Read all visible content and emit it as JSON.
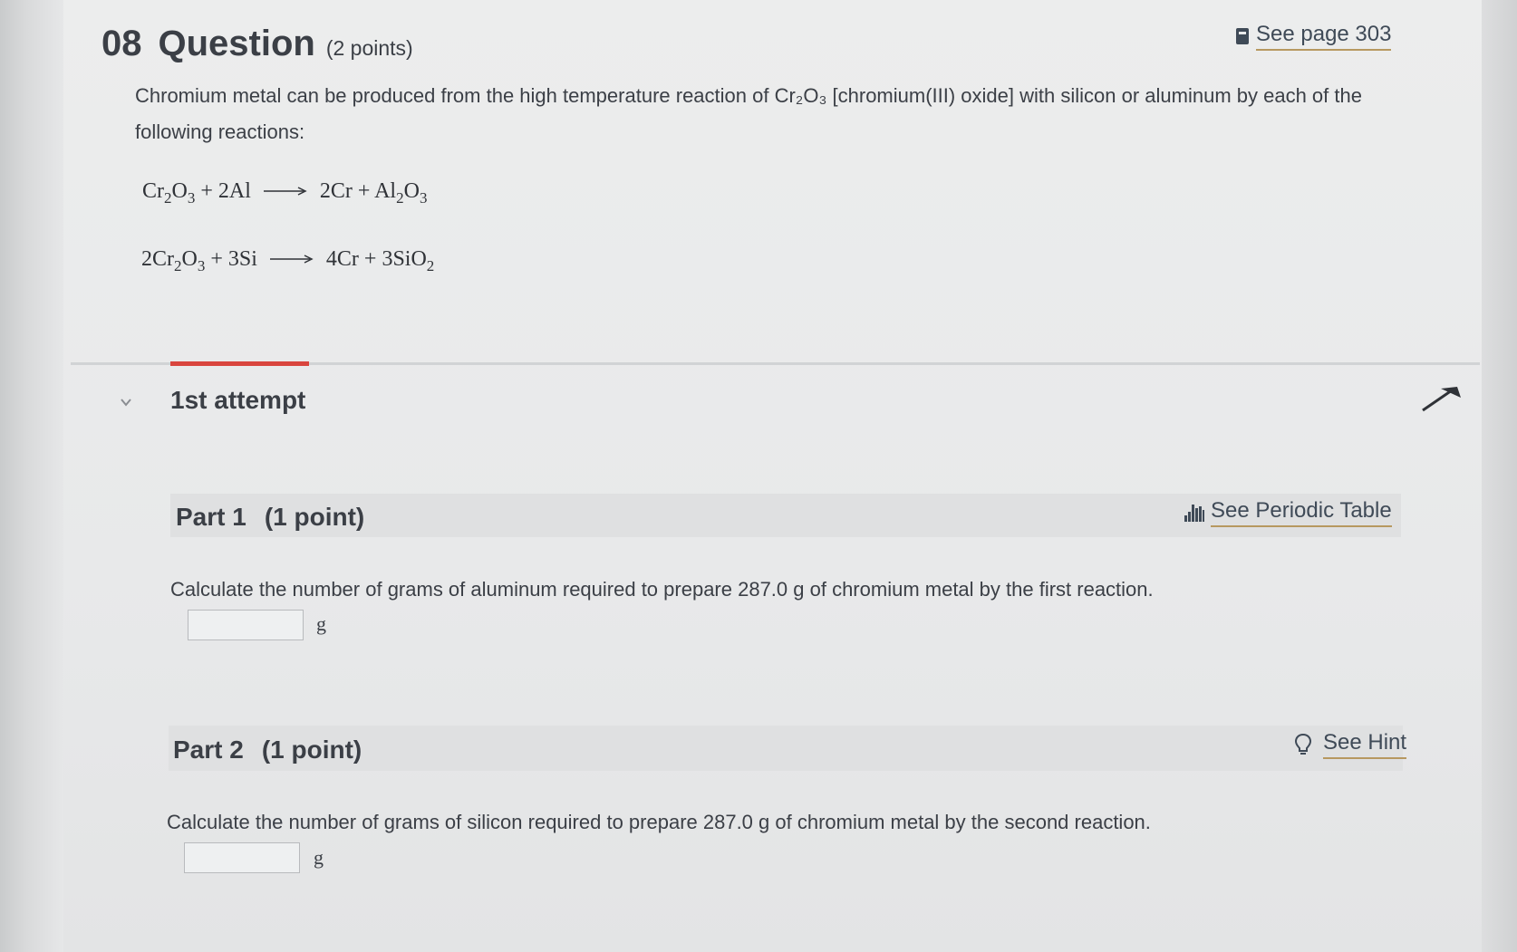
{
  "question": {
    "number": "08",
    "title": "Question",
    "points": "(2 points)",
    "see_page": "See page 303",
    "intro": "Chromium metal can be produced from the high temperature reaction of Cr₂O₃ [chromium(III) oxide] with silicon or aluminum by each of the following reactions:"
  },
  "reactions": [
    {
      "left": [
        "Cr",
        "2",
        "O",
        "3",
        " + 2Al"
      ],
      "right": [
        "2Cr + Al",
        "2",
        "O",
        "3"
      ]
    },
    {
      "left": [
        "2Cr",
        "2",
        "O",
        "3",
        " + 3Si"
      ],
      "right": [
        "4Cr + 3SiO",
        "2"
      ]
    }
  ],
  "attempt": {
    "label": "1st attempt"
  },
  "parts": [
    {
      "title": "Part 1",
      "points": "(1 point)",
      "aid_label": "See Periodic Table",
      "prompt": "Calculate the number of grams of aluminum required to prepare 287.0 g of chromium metal by the first reaction.",
      "answer_value": "",
      "unit": "g"
    },
    {
      "title": "Part 2",
      "points": "(1 point)",
      "aid_label": "See Hint",
      "prompt": "Calculate the number of grams of silicon required to prepare 287.0 g of chromium metal by the second reaction.",
      "answer_value": "",
      "unit": "g"
    }
  ],
  "colors": {
    "accent": "#d9453e",
    "link_underline": "#b79860",
    "text": "#3b3f46"
  }
}
